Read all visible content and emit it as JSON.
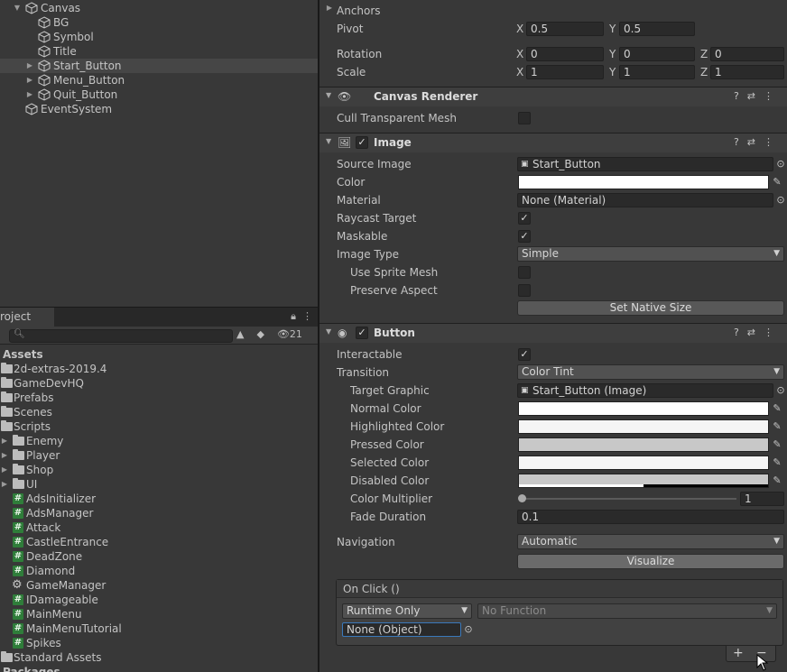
{
  "hierarchy": {
    "items": [
      {
        "label": "Canvas",
        "expanded": true
      },
      {
        "label": "BG"
      },
      {
        "label": "Symbol"
      },
      {
        "label": "Title"
      },
      {
        "label": "Start_Button",
        "selected": true
      },
      {
        "label": "Menu_Button"
      },
      {
        "label": "Quit_Button"
      },
      {
        "label": "EventSystem"
      }
    ]
  },
  "project": {
    "tab_label": "roject",
    "hidden_count": "21",
    "search_placeholder": "",
    "root": "Assets",
    "folders": [
      "2d-extras-2019.4",
      "GameDevHQ",
      "Prefabs",
      "Scenes",
      "Scripts"
    ],
    "script_folders": [
      "Enemy",
      "Player",
      "Shop",
      "UI"
    ],
    "scripts": [
      "AdsInitializer",
      "AdsManager",
      "Attack",
      "CastleEntrance",
      "DeadZone",
      "Diamond",
      "GameManager",
      "IDamageable",
      "MainMenu",
      "MainMenuTutorial",
      "Spikes"
    ],
    "bottom": [
      "Standard Assets",
      "Packages"
    ]
  },
  "inspector": {
    "rect": {
      "anchors": "Anchors",
      "pivot_label": "Pivot",
      "pivot_x": "0.5",
      "pivot_y": "0.5",
      "rotation_label": "Rotation",
      "rot_x": "0",
      "rot_y": "0",
      "rot_z": "0",
      "scale_label": "Scale",
      "scale_x": "1",
      "scale_y": "1",
      "scale_z": "1",
      "x": "X",
      "y": "Y",
      "z": "Z"
    },
    "canvas_renderer": {
      "title": "Canvas Renderer",
      "cull_label": "Cull Transparent Mesh"
    },
    "image": {
      "title": "Image",
      "source_label": "Source Image",
      "source_value": "Start_Button",
      "color_label": "Color",
      "material_label": "Material",
      "material_value": "None (Material)",
      "raycast_label": "Raycast Target",
      "maskable_label": "Maskable",
      "type_label": "Image Type",
      "type_value": "Simple",
      "sprite_mesh_label": "Use Sprite Mesh",
      "preserve_label": "Preserve Aspect",
      "native_btn": "Set Native Size",
      "colors": {
        "color": "#ffffff"
      }
    },
    "button": {
      "title": "Button",
      "interactable_label": "Interactable",
      "transition_label": "Transition",
      "transition_value": "Color Tint",
      "target_label": "Target Graphic",
      "target_value": "Start_Button (Image)",
      "normal_label": "Normal Color",
      "highlighted_label": "Highlighted Color",
      "pressed_label": "Pressed Color",
      "selected_label": "Selected Color",
      "disabled_label": "Disabled Color",
      "multiplier_label": "Color Multiplier",
      "multiplier_value": "1",
      "multiplier_fraction": 0.0,
      "fade_label": "Fade Duration",
      "fade_value": "0.1",
      "navigation_label": "Navigation",
      "navigation_value": "Automatic",
      "visualize_btn": "Visualize",
      "colors": {
        "normal": "#ffffff",
        "highlighted": "#f5f5f5",
        "pressed": "#c8c8c8",
        "selected": "#f5f5f5",
        "disabled": "#c8c8c8"
      }
    },
    "on_click": {
      "title": "On Click ()",
      "mode_value": "Runtime Only",
      "function_value": "No Function",
      "object_value": "None (Object)",
      "add": "+",
      "remove": "−"
    }
  }
}
